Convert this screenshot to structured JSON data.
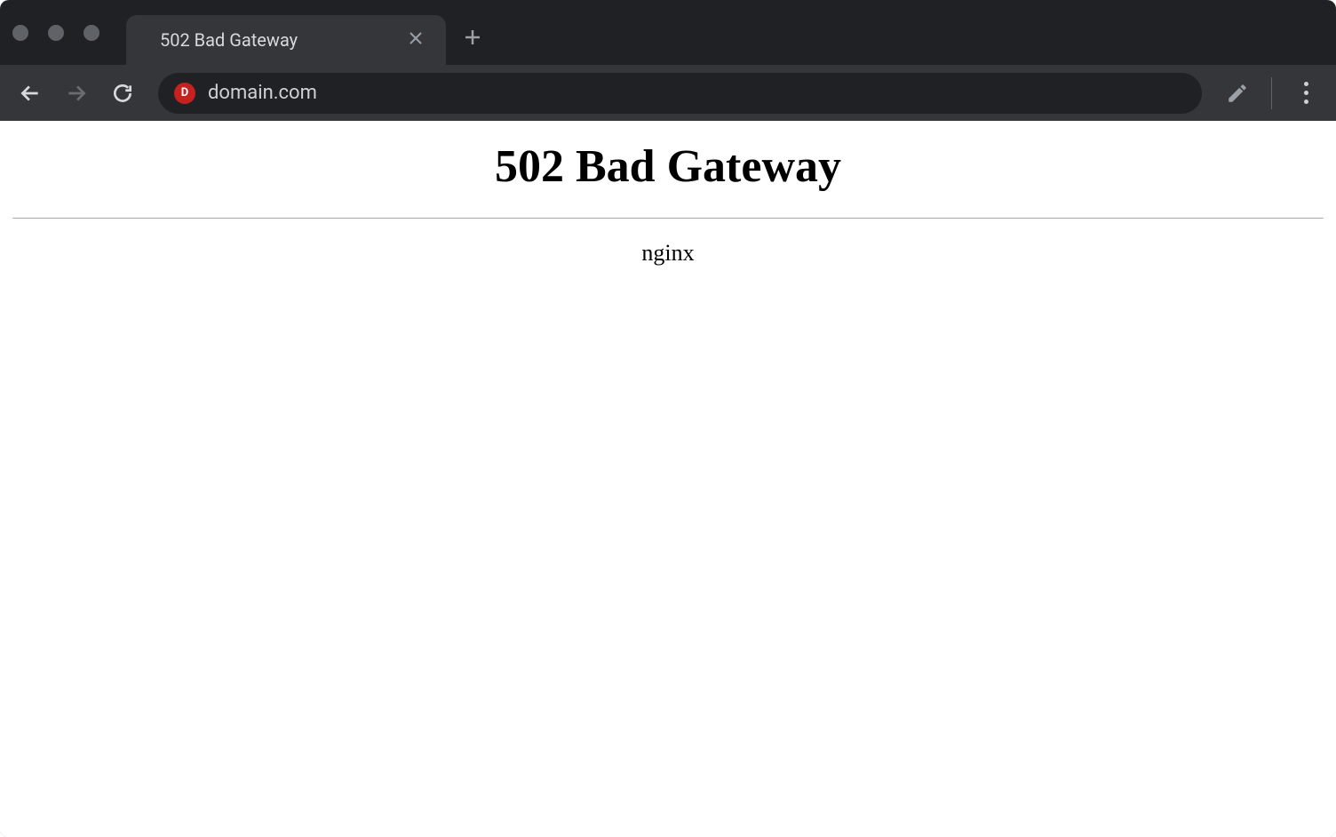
{
  "browser": {
    "tab": {
      "title": "502 Bad Gateway"
    },
    "address_bar": {
      "url": "domain.com",
      "favicon_letter": "D"
    }
  },
  "page": {
    "error_heading": "502 Bad Gateway",
    "server_name": "nginx"
  }
}
